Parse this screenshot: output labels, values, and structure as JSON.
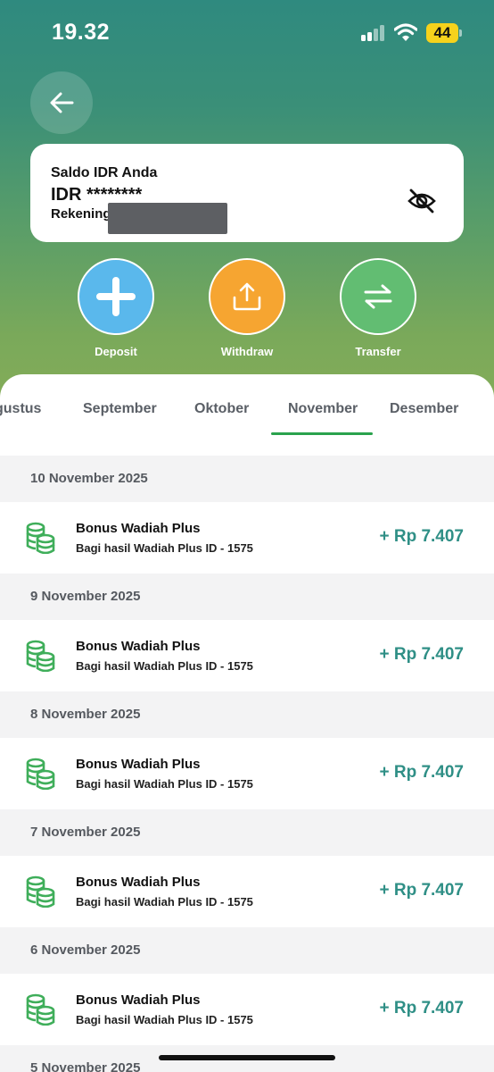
{
  "status_bar": {
    "time": "19.32",
    "battery": "44"
  },
  "balance_card": {
    "title": "Saldo IDR Anda",
    "amount": "IDR ********",
    "account_label": "Rekening"
  },
  "actions": [
    {
      "label": "Deposit",
      "icon": "plus-icon",
      "color": "#5ab8ec"
    },
    {
      "label": "Withdraw",
      "icon": "upload-icon",
      "color": "#f6a531"
    },
    {
      "label": "Transfer",
      "icon": "swap-arrows-icon",
      "color": "#62bd72"
    }
  ],
  "months": {
    "items": [
      "gustus",
      "September",
      "Oktober",
      "November",
      "Desember"
    ],
    "selected": "November",
    "accent": "#2aa24d"
  },
  "transactions": [
    {
      "date": "10 November 2025",
      "title": "Bonus Wadiah Plus",
      "subtitle": "Bagi hasil Wadiah Plus ID - 1575",
      "amount": "+ Rp 7.407"
    },
    {
      "date": "9 November 2025",
      "title": "Bonus Wadiah Plus",
      "subtitle": "Bagi hasil Wadiah Plus ID - 1575",
      "amount": "+ Rp 7.407"
    },
    {
      "date": "8 November 2025",
      "title": "Bonus Wadiah Plus",
      "subtitle": "Bagi hasil Wadiah Plus ID - 1575",
      "amount": "+ Rp 7.407"
    },
    {
      "date": "7 November 2025",
      "title": "Bonus Wadiah Plus",
      "subtitle": "Bagi hasil Wadiah Plus ID - 1575",
      "amount": "+ Rp 7.407"
    },
    {
      "date": "6 November 2025",
      "title": "Bonus Wadiah Plus",
      "subtitle": "Bagi hasil Wadiah Plus ID - 1575",
      "amount": "+ Rp 7.407"
    }
  ],
  "next_date": "5 November 2025",
  "colors": {
    "amount": "#2f8f86",
    "coin_icon": "#3fae5a"
  }
}
